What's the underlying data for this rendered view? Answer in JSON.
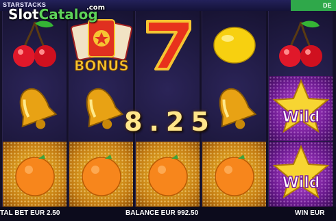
{
  "topbar": {
    "brand": "STARSTACKS",
    "demo_label": "DE"
  },
  "watermark": {
    "part1": "Slot",
    "part2": "Catalog",
    "suffix": ".com"
  },
  "reels": [
    [
      "cherry",
      "bell",
      "orange"
    ],
    [
      "bonus",
      "bell",
      "orange"
    ],
    [
      "seven",
      "blank",
      "orange"
    ],
    [
      "lemon",
      "bell",
      "orange"
    ],
    [
      "cherry",
      "wild",
      "wild"
    ]
  ],
  "symbols": {
    "bonus_text": "BONUS",
    "wild_text": "Wild"
  },
  "win_display": "8.25",
  "bottom": {
    "total_bet": "TAL BET EUR 2.50",
    "balance": "BALANCE EUR 992.50",
    "win": "WIN EUR"
  },
  "colors": {
    "gold": "#f6c432",
    "purple": "#9a2ec0",
    "accent_green": "#2fa84a"
  }
}
